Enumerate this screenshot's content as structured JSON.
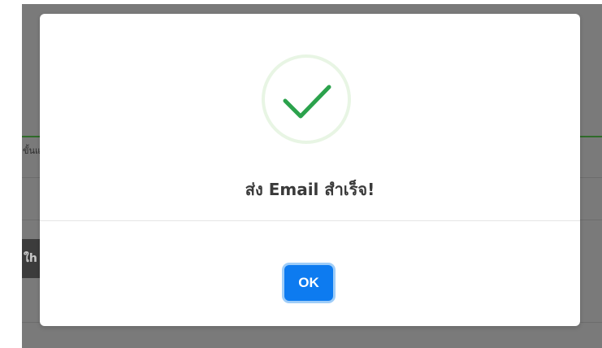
{
  "background": {
    "partial_text": "ขั้นแ",
    "dark_button_label": "ใh"
  },
  "dialog": {
    "icon": "check-icon",
    "title": "ส่ง Email สำเร็จ!",
    "ok_label": "OK"
  },
  "colors": {
    "check_green": "#2ba24c",
    "check_ring": "#e8f5e4",
    "ok_button": "#0d7bf0",
    "overlay_page": "#7a7a7a"
  }
}
